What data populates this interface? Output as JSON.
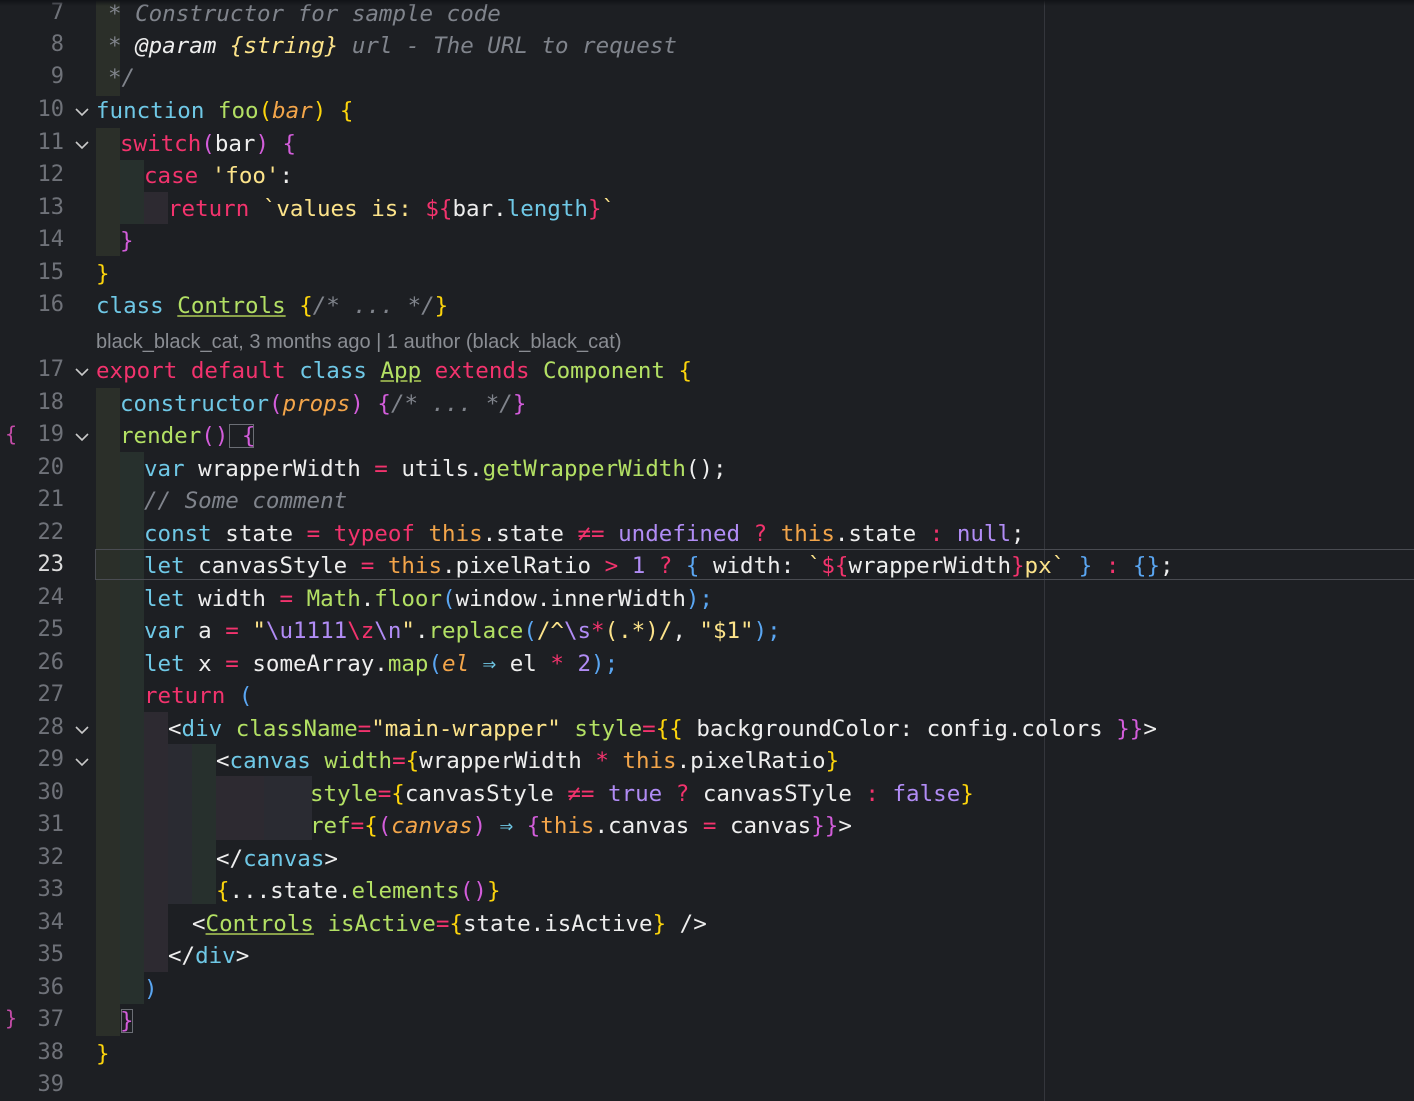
{
  "editor": {
    "language": "javascript",
    "active_line": "23",
    "colors": {
      "background": "#1d1f23",
      "keyword": "#6fc8e6",
      "control": "#f2336d",
      "function": "#b3e064",
      "parameter": "#f3a54a",
      "bracket": "#fcd40c",
      "constant": "#b18cf5",
      "string": "#fce38a",
      "comment": "#80848c"
    },
    "line_numbers": [
      "7",
      "8",
      "9",
      "10",
      "11",
      "12",
      "13",
      "14",
      "15",
      "16",
      "17",
      "18",
      "19",
      "20",
      "21",
      "22",
      "23",
      "24",
      "25",
      "26",
      "27",
      "28",
      "29",
      "30",
      "31",
      "32",
      "33",
      "34",
      "35",
      "36",
      "37",
      "38",
      "39"
    ],
    "blame": "black_black_cat, 3 months ago | 1 author (black_black_cat)",
    "gutter": {
      "open_brace": "{",
      "close_brace": "}"
    },
    "folds": [
      "10",
      "11",
      "17",
      "19",
      "28",
      "29"
    ]
  },
  "code": {
    "l7": [
      "* Constructor for sample code"
    ],
    "l8": [
      "* ",
      "@param",
      " {string}",
      " url - The URL to request"
    ],
    "l9": [
      "*/"
    ],
    "l10": [
      "function",
      " ",
      "foo",
      "(",
      "bar",
      ")",
      " {"
    ],
    "l11": [
      "switch",
      "(",
      "bar",
      ")",
      " {"
    ],
    "l12": [
      "case",
      " 'foo'",
      ":"
    ],
    "l13": [
      "return",
      " `values is: ",
      "${",
      "bar",
      ".",
      "length",
      "}",
      "`"
    ],
    "l14": [
      "}"
    ],
    "l15": [
      "}"
    ],
    "l16": [
      "class",
      " ",
      "Controls",
      " {",
      "/* ... */",
      "}"
    ],
    "l17": [
      "export",
      " ",
      "default",
      " ",
      "class",
      " ",
      "App",
      " ",
      "extends",
      " ",
      "Component",
      " {"
    ],
    "l18": [
      "constructor",
      "(",
      "props",
      ")",
      " {",
      "/* ... */",
      "}"
    ],
    "l19": [
      "render",
      "()",
      " {"
    ],
    "l20": [
      "var",
      " wrapperWidth ",
      "=",
      " utils.",
      "getWrapperWidth",
      "();"
    ],
    "l21": [
      "// Some comment"
    ],
    "l22": [
      "const",
      " state ",
      "=",
      " ",
      "typeof",
      " ",
      "this",
      ".state ",
      "≠=",
      " ",
      "undefined",
      " ",
      "?",
      " ",
      "this",
      ".state ",
      ":",
      " ",
      "null",
      ";"
    ],
    "l23": [
      "let",
      " canvasStyle ",
      "=",
      " ",
      "this",
      ".pixelRatio ",
      ">",
      " ",
      "1",
      " ",
      "?",
      " ",
      "{",
      " width: ",
      "`",
      "${",
      "wrapperWidth",
      "}",
      "px",
      "`",
      " ",
      "}",
      " ",
      ":",
      " ",
      "{}",
      ";"
    ],
    "l24": [
      "let",
      " width ",
      "=",
      " ",
      "Math",
      ".",
      "floor",
      "(",
      "window.innerWidth",
      ");"
    ],
    "l25": [
      "var",
      " a ",
      "=",
      " \"",
      "\\u1111",
      "\\z",
      "\\n",
      "\"",
      ".",
      "replace",
      "(",
      "/^",
      "\\s",
      "*",
      "(.*)",
      "/",
      ", ",
      "\"$1\"",
      ");"
    ],
    "l26": [
      "let",
      " x ",
      "=",
      " someArray.",
      "map",
      "(",
      "el",
      " ",
      "⇒",
      " el ",
      "*",
      " ",
      "2",
      ");"
    ],
    "l27": [
      "return",
      " ("
    ],
    "l28": [
      "<",
      "div",
      " ",
      "className",
      "=",
      "\"main-wrapper\"",
      " ",
      "style",
      "=",
      "{{",
      " backgroundColor: config.colors ",
      "}}",
      ">"
    ],
    "l29": [
      "<",
      "canvas",
      " ",
      "width",
      "=",
      "{",
      "wrapperWidth ",
      "*",
      " ",
      "this",
      ".pixelRatio",
      "}"
    ],
    "l30": [
      "style",
      "=",
      "{",
      "canvasStyle ",
      "≠=",
      " ",
      "true",
      " ",
      "?",
      " canvasSTyle ",
      ":",
      " ",
      "false",
      "}"
    ],
    "l31": [
      "ref",
      "=",
      "{",
      "(",
      "canvas",
      ")",
      " ",
      "⇒",
      " ",
      "{",
      "this",
      ".canvas ",
      "=",
      " canvas",
      "}}",
      ">"
    ],
    "l32": [
      "</",
      "canvas",
      ">"
    ],
    "l33": [
      "{",
      "...state.",
      "elements",
      "()",
      "}"
    ],
    "l34": [
      "<",
      "Controls",
      " ",
      "isActive",
      "=",
      "{",
      "state.isActive",
      "}",
      " />"
    ],
    "l35": [
      "</",
      "div",
      ">"
    ],
    "l36": [
      ")"
    ],
    "l37": [
      "}"
    ],
    "l38": [
      "}"
    ],
    "l39": [
      ""
    ]
  }
}
